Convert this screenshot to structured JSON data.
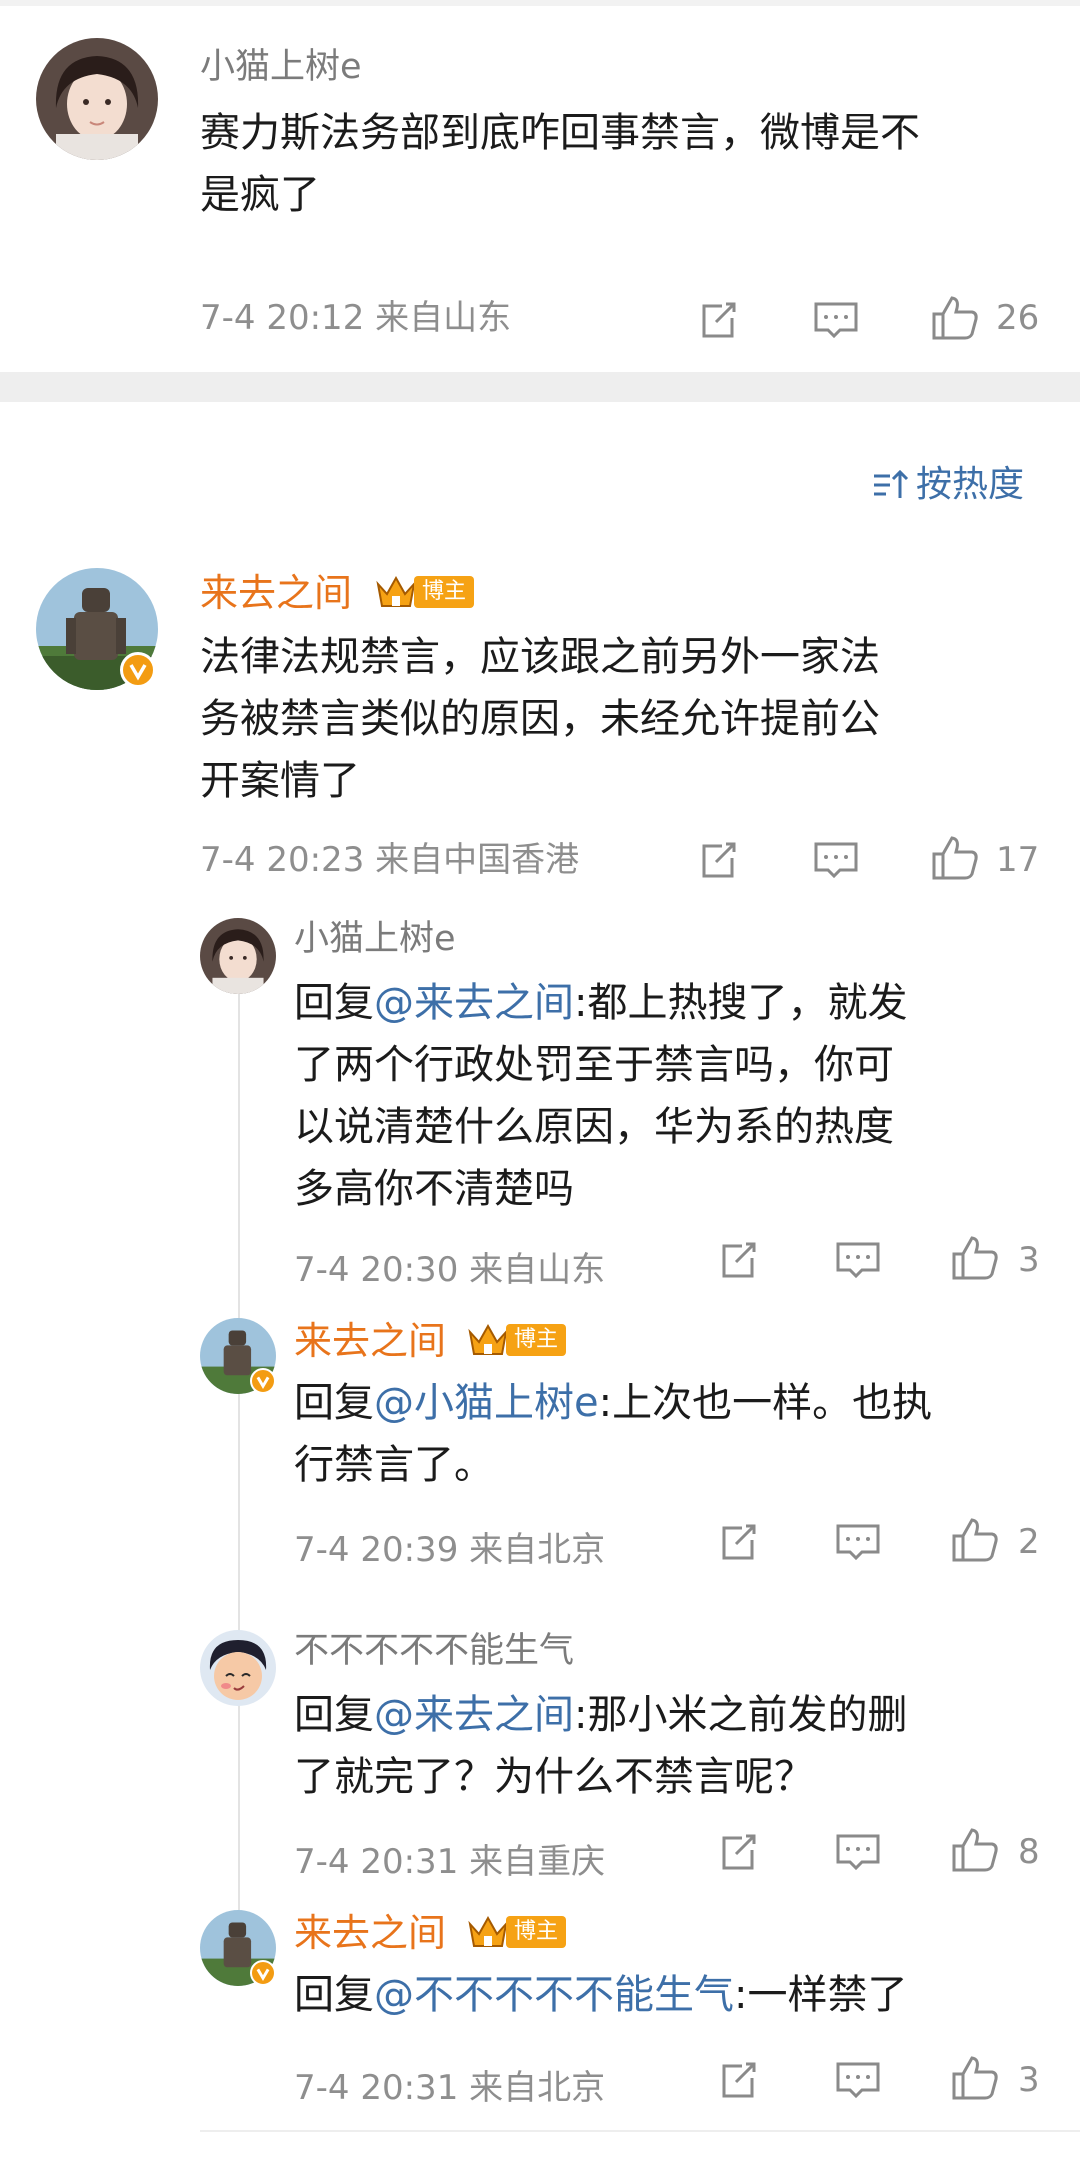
{
  "top_comment": {
    "user": "小猫上树e",
    "text_line1": "赛力斯法务部到底咋回事禁言，微博是不",
    "text_line2": "是疯了",
    "meta": "7-4 20:12 来自山东",
    "likes": "26"
  },
  "sort": {
    "label": "按热度"
  },
  "main_comment": {
    "user": "来去之间",
    "badge": "博主",
    "text_line1": "法律法规禁言，应该跟之前另外一家法",
    "text_line2": "务被禁言类似的原因，未经允许提前公",
    "text_line3": "开案情了",
    "meta": "7-4 20:23 来自中国香港",
    "likes": "17"
  },
  "replies": [
    {
      "user": "小猫上树e",
      "reply_prefix": "回复",
      "mention": "@来去之间",
      "line1_rest": ":都上热搜了，就发",
      "line2": "了两个行政处罚至于禁言吗，你可",
      "line3": "以说清楚什么原因，华为系的热度",
      "line4": "多高你不清楚吗",
      "meta": "7-4 20:30 来自山东",
      "likes": "3"
    },
    {
      "user": "来去之间",
      "badge": "博主",
      "reply_prefix": "回复",
      "mention": "@小猫上树e",
      "line1_rest": ":上次也一样。也执",
      "line2": "行禁言了。",
      "meta": "7-4 20:39 来自北京",
      "likes": "2"
    },
    {
      "user": "不不不不不能生气",
      "reply_prefix": "回复",
      "mention": "@来去之间",
      "line1_rest": ":那小米之前发的删",
      "line2": "了就完了？为什么不禁言呢？",
      "meta": "7-4 20:31 来自重庆",
      "likes": "8"
    },
    {
      "user": "来去之间",
      "badge": "博主",
      "reply_prefix": "回复",
      "mention": "@不不不不不能生气",
      "line1_rest": ":一样禁了",
      "meta": "7-4 20:31 来自北京",
      "likes": "3"
    }
  ],
  "colors": {
    "accent_orange": "#e8741b",
    "mention_blue": "#3d6fa8",
    "badge_orange": "#f6a214",
    "divider": "#eeeeee"
  },
  "icons": [
    "share-icon",
    "comment-icon",
    "like-icon",
    "sort-icon",
    "crown-icon",
    "verified-icon"
  ]
}
